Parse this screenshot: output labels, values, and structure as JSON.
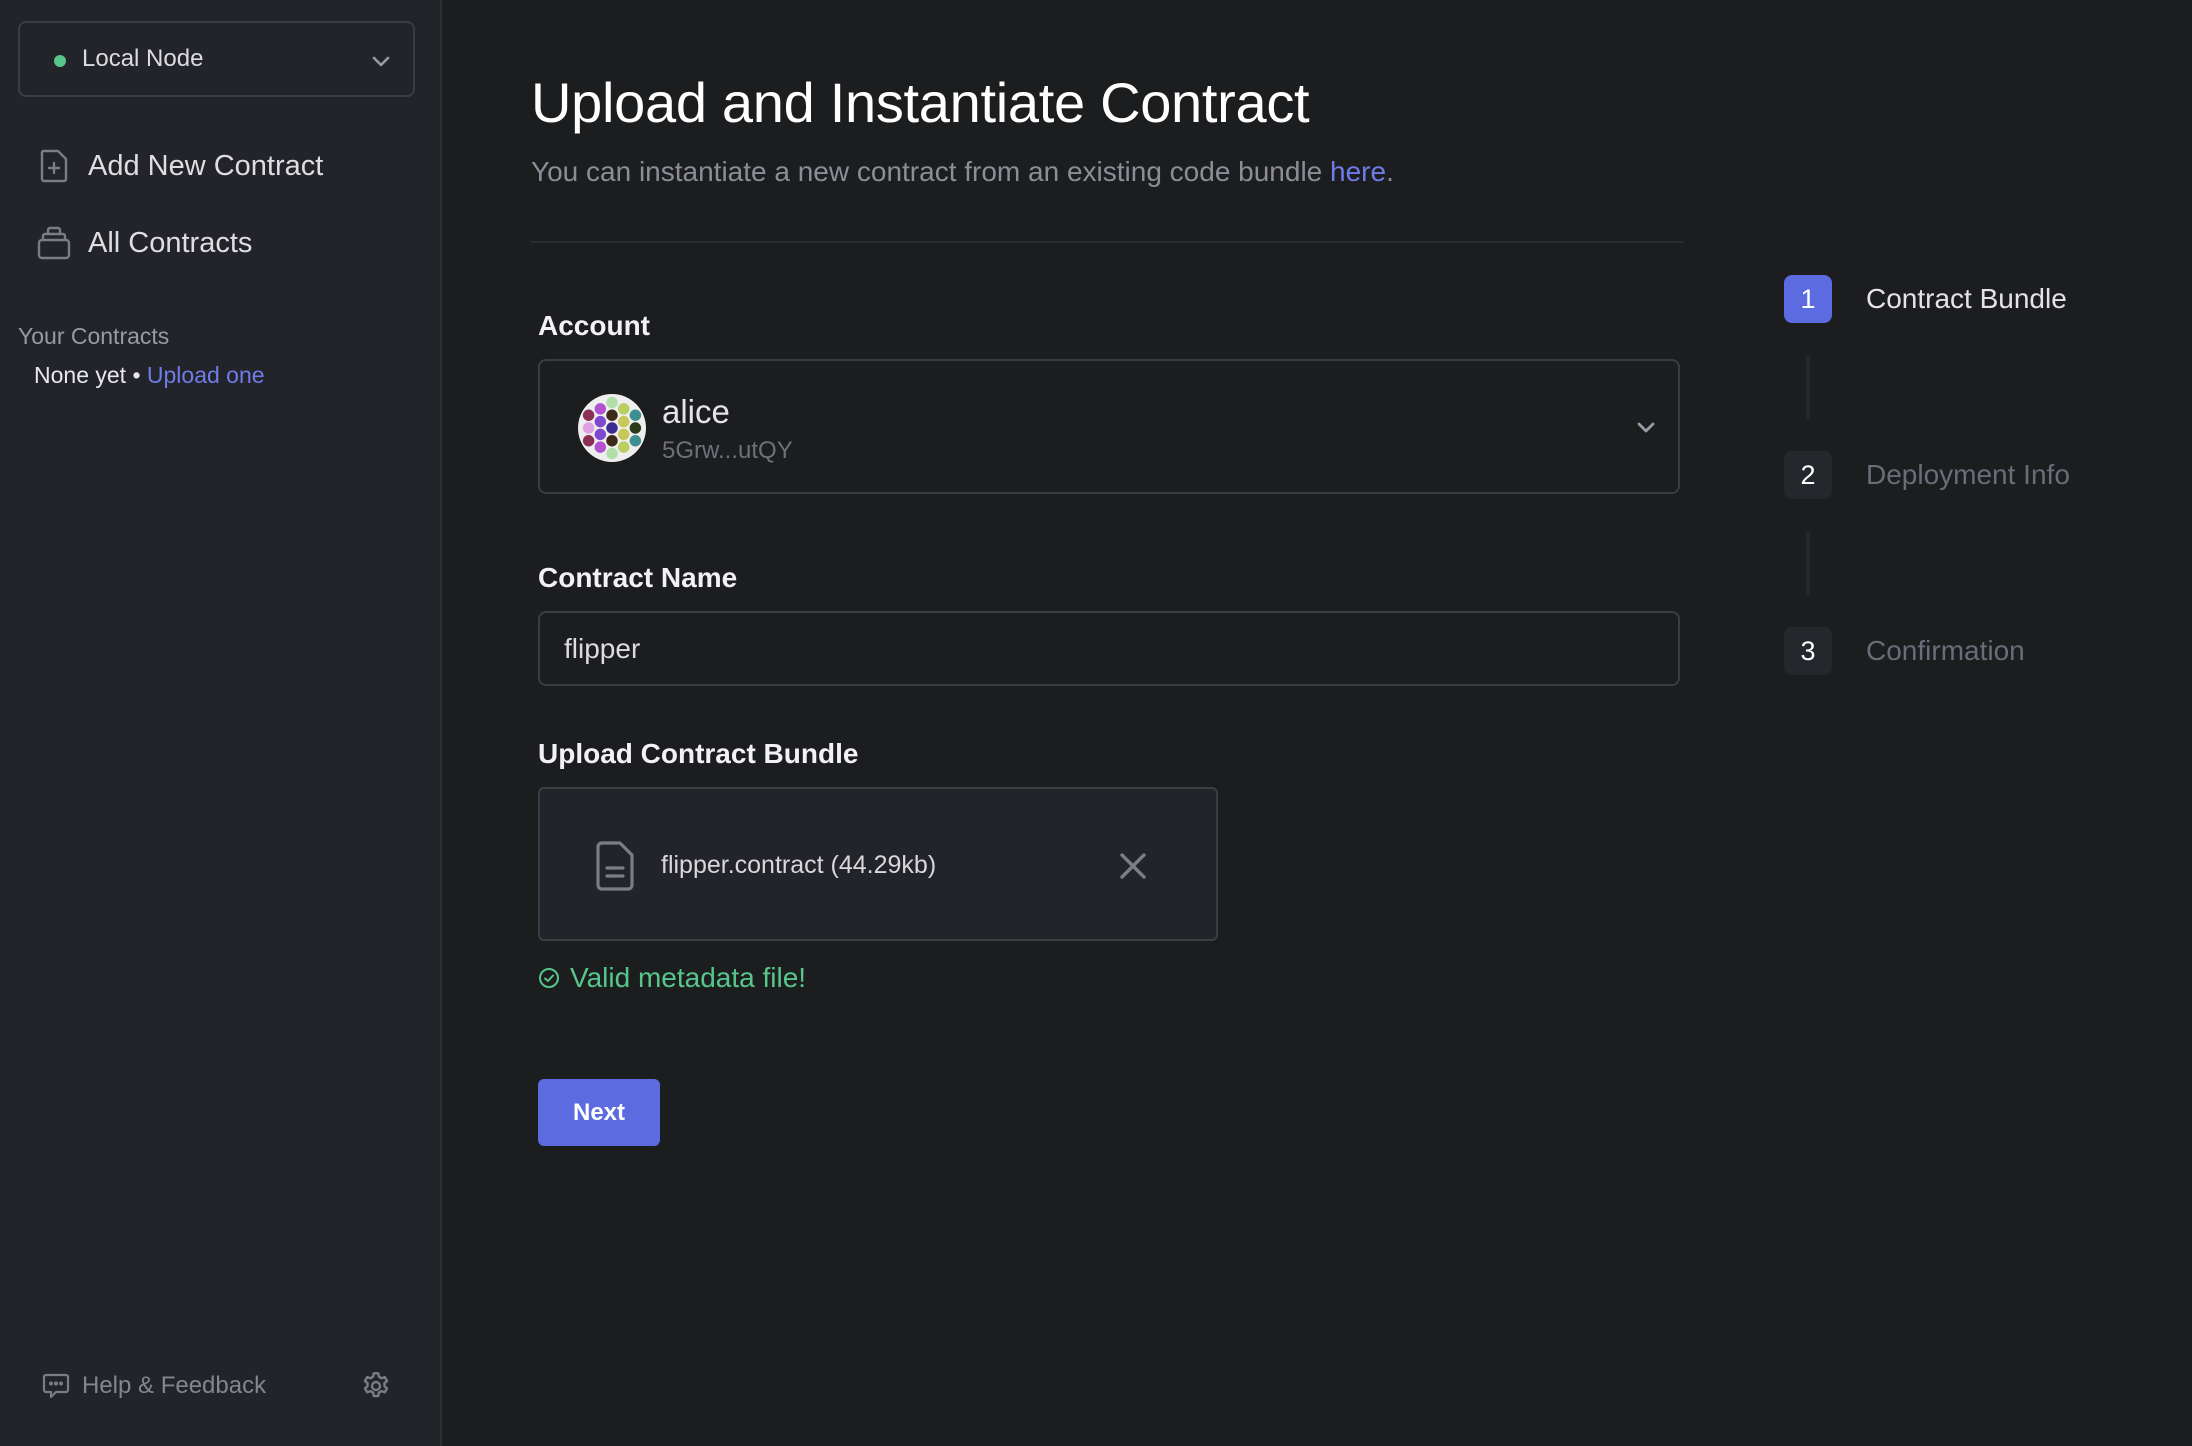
{
  "sidebar": {
    "node_selector": {
      "label": "Local Node",
      "status_color": "#56c68a",
      "icon": "chevron-down-icon"
    },
    "nav": [
      {
        "label": "Add New Contract",
        "icon": "file-plus-icon"
      },
      {
        "label": "All Contracts",
        "icon": "archive-icon"
      }
    ],
    "your_contracts": {
      "heading": "Your Contracts",
      "empty_text": "None yet",
      "separator": " • ",
      "upload_link": "Upload one"
    },
    "footer": {
      "help_label": "Help & Feedback",
      "help_icon": "chat-bubble-icon",
      "settings_icon": "gear-icon"
    }
  },
  "main": {
    "title": "Upload and Instantiate Contract",
    "subtitle": {
      "text": "You can instantiate a new contract from an existing code bundle ",
      "link": "here",
      "suffix": "."
    },
    "account": {
      "label": "Account",
      "name": "alice",
      "address": "5Grw...utQY",
      "identicon_colors": {
        "outer_left": [
          "#8a3058",
          "#dda0e0",
          "#8a3058"
        ],
        "inner_left": [
          "#b352cf",
          "#8048cc",
          "#8048cc",
          "#b352cf"
        ],
        "center": [
          "#b0e0a8",
          "#3e2a18",
          "#3c2a90",
          "#3e2a18",
          "#b0e0a8"
        ],
        "inner_right": [
          "#b8d060",
          "#c8c858",
          "#c8c858",
          "#b8d060"
        ],
        "outer_right": [
          "#3f8e8e",
          "#2a3a18",
          "#3f8e8e"
        ]
      }
    },
    "contract_name": {
      "label": "Contract Name",
      "value": "flipper"
    },
    "upload": {
      "label": "Upload Contract Bundle",
      "file_name": "flipper.contract (44.29kb)",
      "file_icon": "document-icon",
      "remove_icon": "close-icon"
    },
    "validation": {
      "text": "Valid metadata file!",
      "color": "#56c68a",
      "icon": "check-circle-icon"
    },
    "next_button": "Next"
  },
  "stepper": {
    "steps": [
      {
        "number": "1",
        "label": "Contract Bundle",
        "active": true
      },
      {
        "number": "2",
        "label": "Deployment Info",
        "active": false
      },
      {
        "number": "3",
        "label": "Confirmation",
        "active": false
      }
    ]
  },
  "colors": {
    "accent": "#5c6be0",
    "link": "#6f7ce8",
    "success": "#56c68a"
  }
}
